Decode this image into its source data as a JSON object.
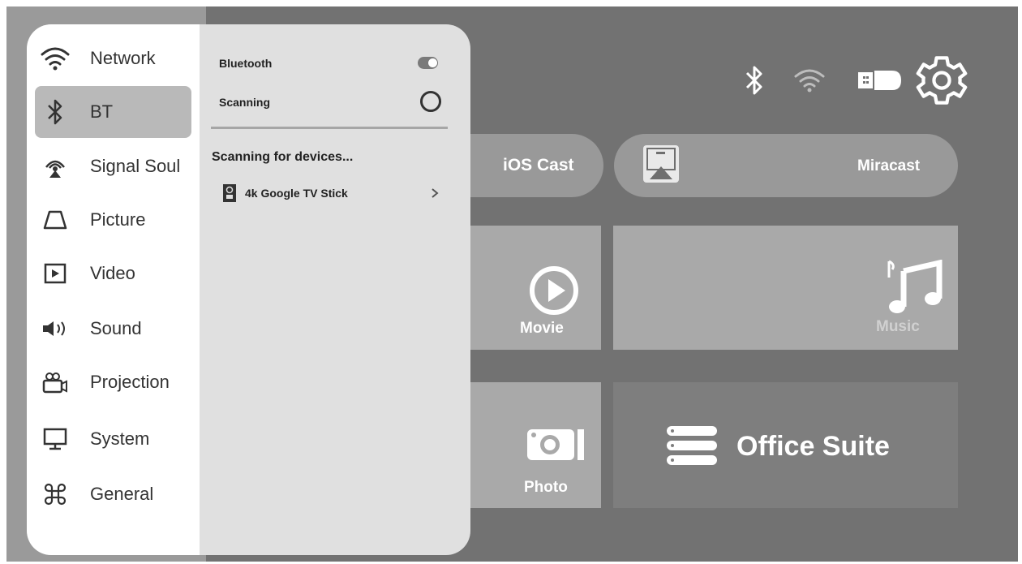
{
  "settings_menu": {
    "items": [
      {
        "icon": "wifi-icon",
        "label": "Network",
        "active": false
      },
      {
        "icon": "bluetooth-icon",
        "label": "BT",
        "active": true
      },
      {
        "icon": "signal-source-icon",
        "label": "Signal Soul",
        "active": false
      },
      {
        "icon": "picture-icon",
        "label": "Picture",
        "active": false
      },
      {
        "icon": "video-icon",
        "label": "Video",
        "active": false
      },
      {
        "icon": "speaker-icon",
        "label": "Sound",
        "active": false
      },
      {
        "icon": "projector-icon",
        "label": "Projection",
        "active": false
      },
      {
        "icon": "monitor-icon",
        "label": "System",
        "active": false
      },
      {
        "icon": "command-icon",
        "label": "General",
        "active": false
      }
    ]
  },
  "bt_panel": {
    "bluetooth_label": "Bluetooth",
    "bluetooth_enabled": true,
    "scanning_label": "Scanning",
    "scanning_status": "Scanning for devices...",
    "devices": [
      {
        "icon": "remote-icon",
        "name": "4k Google TV Stick"
      }
    ]
  },
  "status_bar": {
    "icons": [
      "bluetooth-icon",
      "wifi-icon",
      "usb-drive-icon",
      "settings-gear-icon"
    ]
  },
  "home": {
    "cast_buttons": [
      {
        "label": "iOS Cast"
      },
      {
        "label": "Miracast",
        "icon": "miracast-icon"
      }
    ],
    "tiles": [
      {
        "label": "Movie",
        "icon": "play-icon"
      },
      {
        "label": "Music",
        "icon": "music-note-icon"
      },
      {
        "label": "Photo",
        "icon": "camera-icon"
      },
      {
        "label": "Office Suite",
        "icon": "office-stack-icon"
      }
    ]
  },
  "colors": {
    "screen_background": "#727272",
    "panel_background": "#e0e0e0",
    "menu_background": "#ffffff",
    "menu_active": "#b9b9b9",
    "tile_background": "#a9a9a9"
  }
}
